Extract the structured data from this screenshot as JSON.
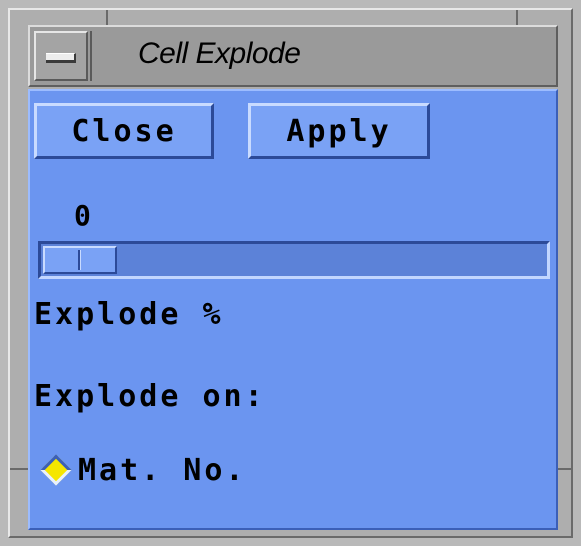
{
  "window": {
    "title": "Cell Explode"
  },
  "buttons": {
    "close_label": "Close",
    "apply_label": "Apply"
  },
  "explode_scale": {
    "value_text": "0",
    "value": 0,
    "label": "Explode %"
  },
  "explode_on": {
    "label": "Explode on:",
    "toggle_label": "Mat. No.",
    "toggle_selected": true
  },
  "colors": {
    "client_background": "#6b95f0",
    "chrome_gray": "#aeaeae",
    "toggle_indicator": "#f5e600"
  },
  "icons": {
    "window_menu": "window-menu-icon",
    "toggle_indicator": "diamond-toggle-icon"
  }
}
